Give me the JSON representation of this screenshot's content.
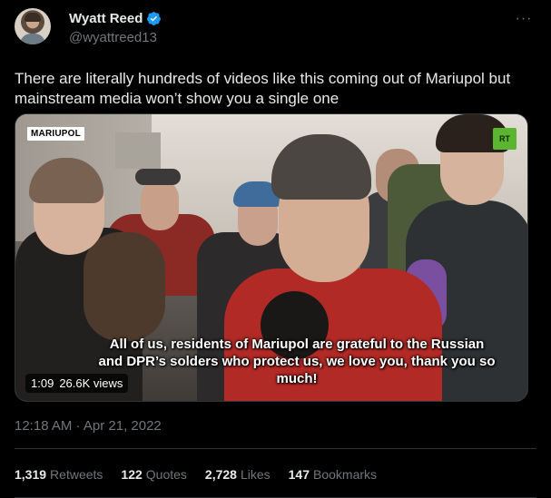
{
  "author": {
    "display_name": "Wyatt Reed",
    "handle": "@wyattreed13",
    "verified_icon": "verified-badge-icon",
    "verified_color": "#1d9bf0"
  },
  "more_icon": "more-horizontal-icon",
  "tweet": {
    "text": "There are literally hundreds of videos like this coming out of Mariupol but mainstream media won’t show you a single one"
  },
  "media": {
    "location_tag": "MARIUPOL",
    "channel_logo": "RT",
    "subtitle": "All of us, residents of Mariupol are grateful to the Russian and DPR’s solders who protect us, we love you, thank you so much!",
    "duration": "1:09",
    "views": "26.6K views"
  },
  "timestamp": "12:18 AM · Apr 21, 2022",
  "stats": [
    {
      "value": "1,319",
      "label": "Retweets"
    },
    {
      "value": "122",
      "label": "Quotes"
    },
    {
      "value": "2,728",
      "label": "Likes"
    },
    {
      "value": "147",
      "label": "Bookmarks"
    }
  ],
  "colors": {
    "background": "#000000",
    "text_primary": "#e7e9ea",
    "text_secondary": "#71767b",
    "border": "#2f3336"
  }
}
